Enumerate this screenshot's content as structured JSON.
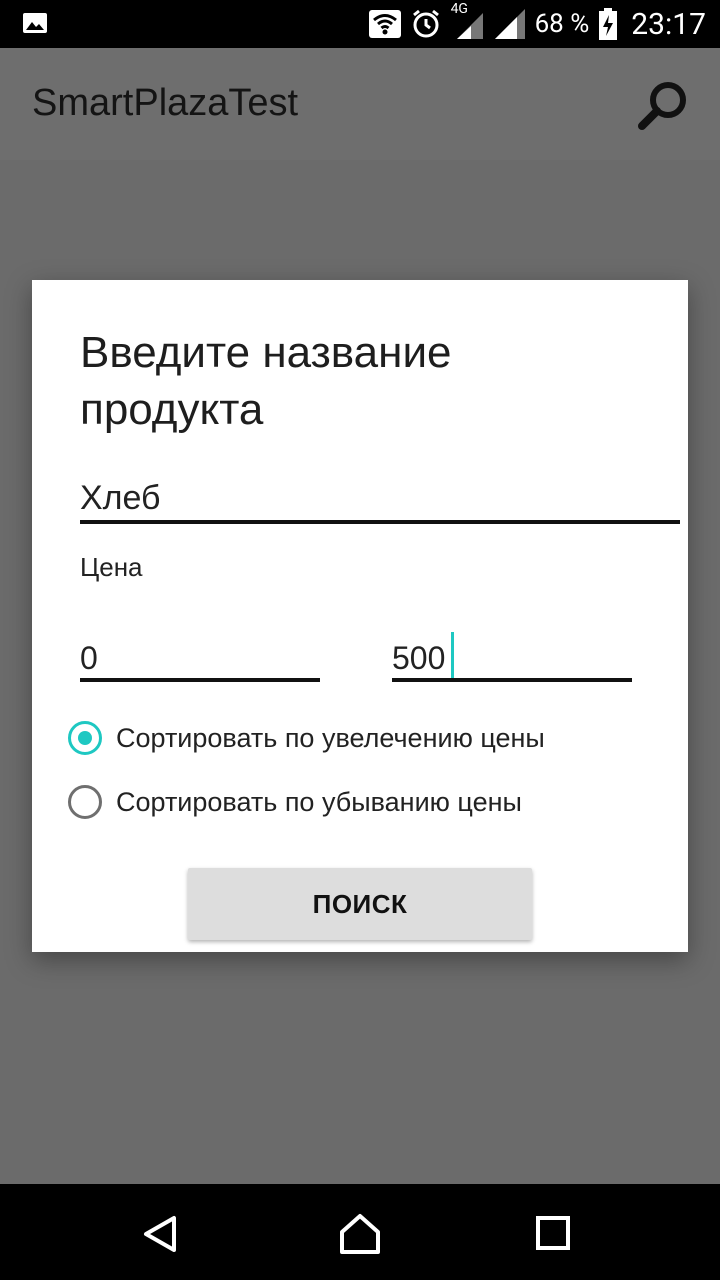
{
  "status_bar": {
    "network": "4G",
    "battery_percent": "68 %",
    "time": "23:17"
  },
  "app_bar": {
    "title": "SmartPlazaTest",
    "search_icon": "search-icon"
  },
  "dialog": {
    "title": "Введите название продукта",
    "product_name_value": "Хлеб",
    "price_label": "Цена",
    "price_min_value": "0",
    "price_max_value": "500",
    "sort_options": [
      {
        "label": "Сортировать по увелечению цены",
        "selected": true
      },
      {
        "label": "Сортировать по убыванию цены",
        "selected": false
      }
    ],
    "search_button_label": "ПОИСК"
  },
  "colors": {
    "accent": "#1ec8c2",
    "scrim": "#6b6b6b",
    "status_bar": "#000000",
    "button_bg": "#dddddd"
  }
}
